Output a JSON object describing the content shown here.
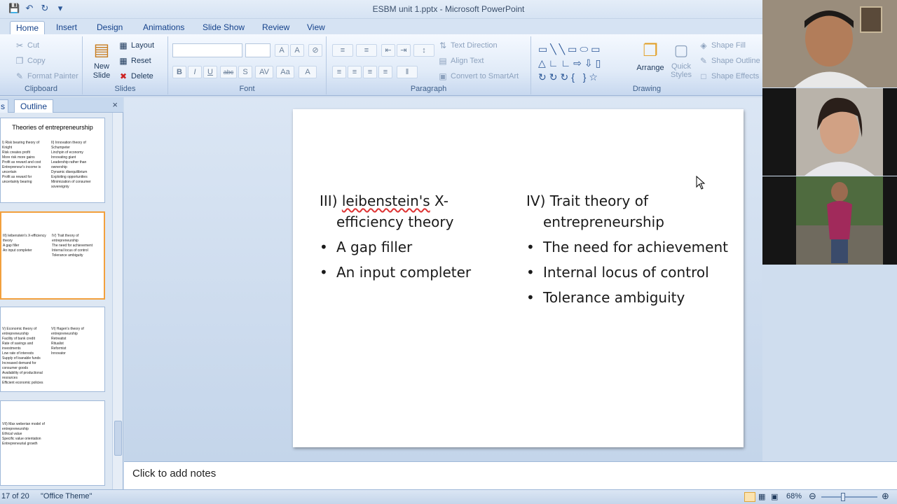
{
  "window": {
    "title": "ESBM unit 1.pptx - Microsoft PowerPoint"
  },
  "tabs": [
    "Home",
    "Insert",
    "Design",
    "Animations",
    "Slide Show",
    "Review",
    "View"
  ],
  "clipboard": {
    "cut": "Cut",
    "copy": "Copy",
    "format_painter": "Format Painter",
    "label": "Clipboard"
  },
  "slides_group": {
    "new_slide": "New Slide",
    "layout": "Layout",
    "reset": "Reset",
    "delete": "Delete",
    "label": "Slides"
  },
  "font_group": {
    "bold": "B",
    "italic": "I",
    "underline": "U",
    "strike": "abc",
    "shadow": "S",
    "spacing": "AV",
    "case": "Aa",
    "color": "A",
    "label": "Font"
  },
  "paragraph_group": {
    "text_direction": "Text Direction",
    "align_text": "Align Text",
    "convert_smartart": "Convert to SmartArt",
    "label": "Paragraph"
  },
  "drawing_group": {
    "arrange": "Arrange",
    "quick_styles": "Quick Styles",
    "shape_fill": "Shape Fill",
    "shape_outline": "Shape Outline",
    "shape_effects": "Shape Effects",
    "label": "Drawing"
  },
  "left_pane": {
    "tabs": [
      "s",
      "Outline"
    ],
    "close": "×",
    "thumbnails": [
      {
        "title": "Theories of entrepreneurship",
        "left": [
          "I) Risk bearing theory of Knight",
          "Risk creates profit",
          "More risk more gains",
          "Profit as reward and cost",
          "Entrepreneur's income is uncertain",
          "Profit as reward for uncertainty bearing"
        ],
        "right": [
          "II) Innovation theory of Schumpeter",
          "Linchpin of economy",
          "Innovating giant",
          "Leadership rather than ownership",
          "Dynamic disequilibrium",
          "Exploiting opportunities",
          "Minimization of consumer sovereignty"
        ]
      },
      {
        "title": "",
        "left": [
          "III) leibenstein's X-efficiency theory",
          "A gap filler",
          "An input completer"
        ],
        "right": [
          "IV) Trait theory of entrepreneurship",
          "The need for achievement",
          "Internal locus of control",
          "Tolerance ambiguity"
        ]
      },
      {
        "title": "",
        "left": [
          "V) Economic theory of entrepreneurship",
          "Facility of bank credit",
          "Rate of savings and investments",
          "Low rate of interests",
          "Supply of loanable funds",
          "Increased demand for consumer goods",
          "Availability of productional resources",
          "Efficient economic policies"
        ],
        "right": [
          "VI) Hagen's theory of entrepreneurship",
          "Retreatist",
          "Ritualist",
          "Reformist",
          "Innovator"
        ]
      },
      {
        "title": "",
        "left": [
          "VII) Max weberian model of entrepreneurship",
          "Ethical value",
          "Specific value orientation",
          "Entrepreneurial growth"
        ],
        "right": []
      }
    ]
  },
  "slide": {
    "left_heading_prefix": "III) ",
    "left_heading_misspelled": "leibenstein's",
    "left_heading_rest": " X-efficiency theory",
    "left_bullets": [
      "A gap filler",
      "An input completer"
    ],
    "right_heading": "IV) Trait theory of entrepreneurship",
    "right_bullets": [
      "The need for achievement",
      "Internal locus of control",
      "Tolerance ambiguity"
    ]
  },
  "notes": {
    "placeholder": "Click to add notes"
  },
  "status": {
    "slide_info": "17 of 20",
    "theme": "\"Office Theme\"",
    "zoom": "68%"
  },
  "colors": {
    "ribbon": "#dfe9f5",
    "selected_thumb": "#f2a03d",
    "text": "#15428b"
  }
}
